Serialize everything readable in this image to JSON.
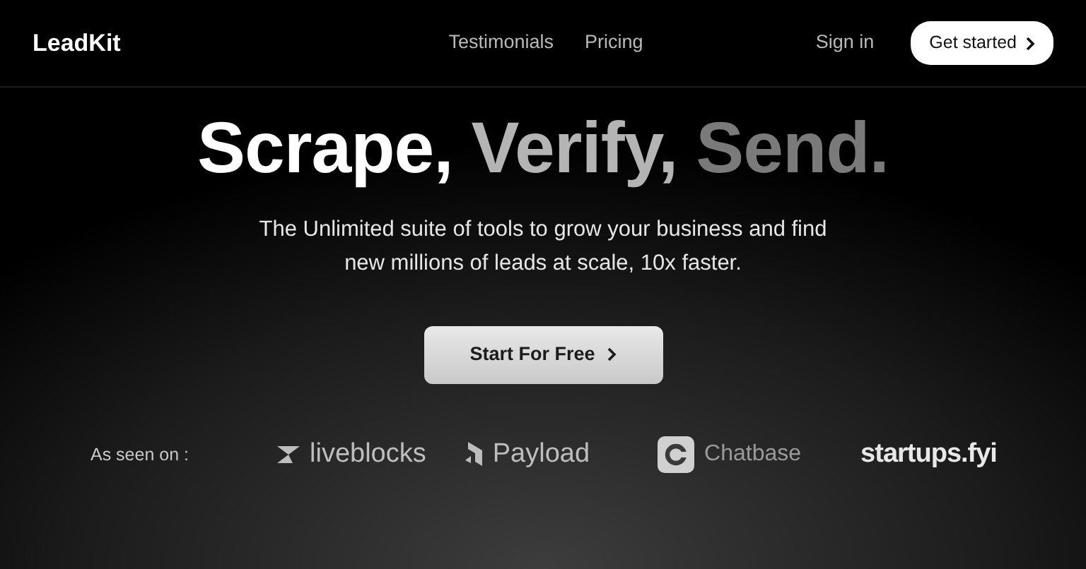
{
  "navbar": {
    "brand": "LeadKit",
    "links": [
      {
        "label": "Testimonials"
      },
      {
        "label": "Pricing"
      }
    ],
    "sign_in": "Sign in",
    "cta": "Get started"
  },
  "hero": {
    "headline": [
      {
        "text": "Scrape,",
        "color": "#ffffff"
      },
      {
        "text": "Verify,",
        "color": "#b4b4b4"
      },
      {
        "text": "Send.",
        "color": "#7a7a7a"
      }
    ],
    "subtitle_lines": [
      "The Unlimited suite of tools to grow your business and find",
      "new millions of leads at scale, 10x faster."
    ],
    "button": "Start For Free"
  },
  "as_seen_on": {
    "label": "As seen on :",
    "logos": [
      {
        "kind": "liveblocks",
        "name": "liveblocks"
      },
      {
        "kind": "payload",
        "name": "Payload"
      },
      {
        "kind": "chatbase",
        "name": "Chatbase"
      },
      {
        "kind": "startups",
        "name": "startups.fyi"
      }
    ]
  }
}
